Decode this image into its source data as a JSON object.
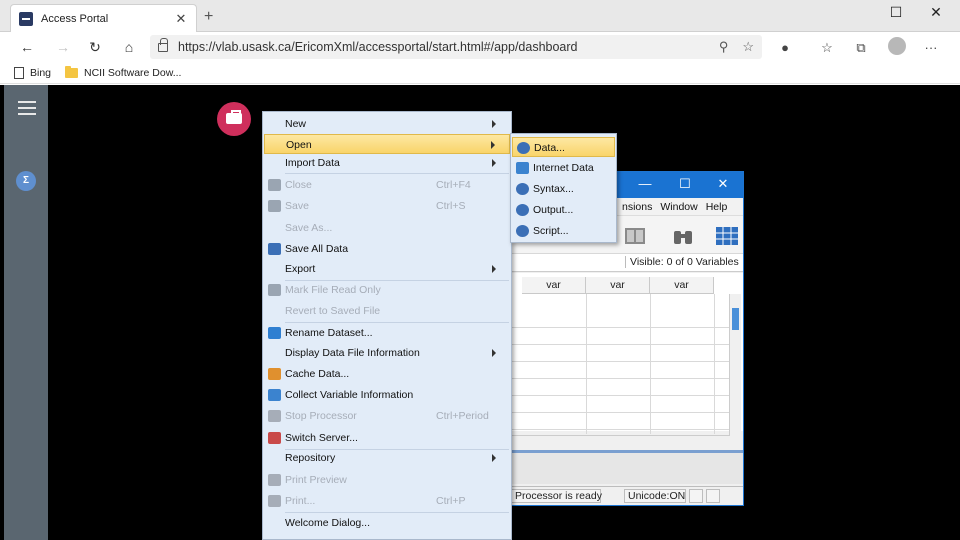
{
  "browser": {
    "tab_title": "Access Portal",
    "new_tab": "+",
    "url": "https://vlab.usask.ca/EricomXml/accessportal/start.html#/app/dashboard",
    "favorites": [
      "Bing",
      "NCII Software Dow..."
    ],
    "more": "···"
  },
  "spss": {
    "menubar": [
      "nsions",
      "Window",
      "Help"
    ],
    "visible": "Visible: 0 of 0 Variables",
    "columns": [
      "var",
      "var",
      "var"
    ],
    "status_processor": "Processor is ready",
    "status_unicode": "Unicode:ON"
  },
  "file_menu": {
    "items": [
      {
        "label": "New",
        "shortcut": "",
        "disabled": false,
        "submenu": true,
        "highlighted": false,
        "icon": ""
      },
      {
        "label": "Open",
        "shortcut": "",
        "disabled": false,
        "submenu": true,
        "highlighted": true,
        "icon": ""
      },
      {
        "label": "Import Data",
        "shortcut": "",
        "disabled": false,
        "submenu": true,
        "highlighted": false,
        "icon": ""
      },
      {
        "label": "Close",
        "shortcut": "Ctrl+F4",
        "disabled": true,
        "submenu": false,
        "highlighted": false,
        "icon": "close-icon"
      },
      {
        "label": "Save",
        "shortcut": "Ctrl+S",
        "disabled": true,
        "submenu": false,
        "highlighted": false,
        "icon": "save-icon"
      },
      {
        "label": "Save As...",
        "shortcut": "",
        "disabled": true,
        "submenu": false,
        "highlighted": false,
        "icon": ""
      },
      {
        "label": "Save All Data",
        "shortcut": "",
        "disabled": false,
        "submenu": false,
        "highlighted": false,
        "icon": "save-all-icon"
      },
      {
        "label": "Export",
        "shortcut": "",
        "disabled": false,
        "submenu": true,
        "highlighted": false,
        "icon": ""
      },
      {
        "label": "Mark File Read Only",
        "shortcut": "",
        "disabled": true,
        "submenu": false,
        "highlighted": false,
        "icon": "read-only-icon"
      },
      {
        "label": "Revert to Saved File",
        "shortcut": "",
        "disabled": true,
        "submenu": false,
        "highlighted": false,
        "icon": ""
      },
      {
        "label": "Rename Dataset...",
        "shortcut": "",
        "disabled": false,
        "submenu": false,
        "highlighted": false,
        "icon": "rename-icon"
      },
      {
        "label": "Display Data File Information",
        "shortcut": "",
        "disabled": false,
        "submenu": true,
        "highlighted": false,
        "icon": ""
      },
      {
        "label": "Cache Data...",
        "shortcut": "",
        "disabled": false,
        "submenu": false,
        "highlighted": false,
        "icon": "cache-icon"
      },
      {
        "label": "Collect Variable Information",
        "shortcut": "",
        "disabled": false,
        "submenu": false,
        "highlighted": false,
        "icon": "collect-icon"
      },
      {
        "label": "Stop Processor",
        "shortcut": "Ctrl+Period",
        "disabled": true,
        "submenu": false,
        "highlighted": false,
        "icon": "stop-icon"
      },
      {
        "label": "Switch Server...",
        "shortcut": "",
        "disabled": false,
        "submenu": false,
        "highlighted": false,
        "icon": "server-icon"
      },
      {
        "label": "Repository",
        "shortcut": "",
        "disabled": false,
        "submenu": true,
        "highlighted": false,
        "icon": ""
      },
      {
        "label": "Print Preview",
        "shortcut": "",
        "disabled": true,
        "submenu": false,
        "highlighted": false,
        "icon": "print-preview-icon"
      },
      {
        "label": "Print...",
        "shortcut": "Ctrl+P",
        "disabled": true,
        "submenu": false,
        "highlighted": false,
        "icon": "print-icon"
      },
      {
        "label": "Welcome Dialog...",
        "shortcut": "",
        "disabled": false,
        "submenu": false,
        "highlighted": false,
        "icon": ""
      }
    ]
  },
  "open_submenu": {
    "items": [
      {
        "label": "Data...",
        "highlighted": true,
        "icon": "data-icon"
      },
      {
        "label": "Internet Data",
        "highlighted": false,
        "icon": "internet-data-icon"
      },
      {
        "label": "Syntax...",
        "highlighted": false,
        "icon": "syntax-icon"
      },
      {
        "label": "Output...",
        "highlighted": false,
        "icon": "output-icon"
      },
      {
        "label": "Script...",
        "highlighted": false,
        "icon": "script-icon"
      }
    ]
  },
  "colors": {
    "menu_bg": "#e2ecf8",
    "highlight": "#f9d46a",
    "spss_title": "#1a73d2",
    "portal_bg": "#000000",
    "rail": "#5a6670",
    "toolbox": "#cf2f5c"
  }
}
